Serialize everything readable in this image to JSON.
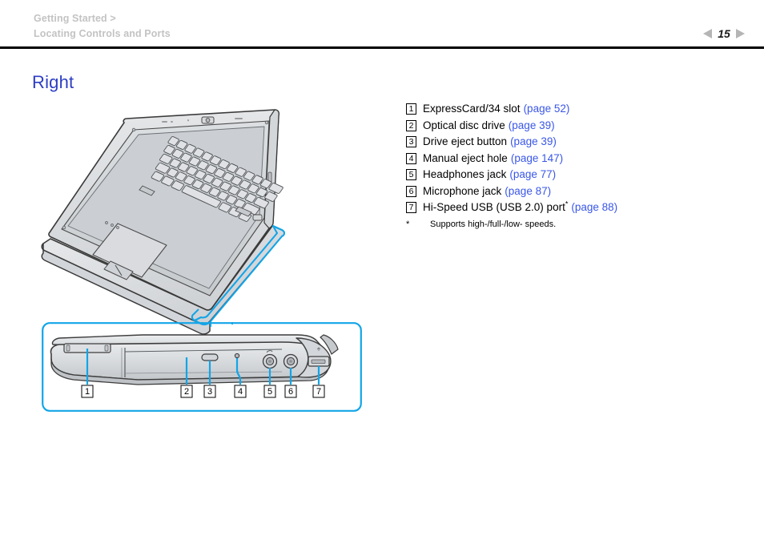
{
  "header": {
    "breadcrumb_line1": "Getting Started >",
    "breadcrumb_line2": "Locating Controls and Ports",
    "page_number": "15",
    "prev_icon": "triangle-left-icon",
    "next_icon": "triangle-right-icon"
  },
  "page": {
    "title": "Right",
    "title_color": "#2c3ec4",
    "link_color": "#3a57e8",
    "highlight_color": "#12a5e8"
  },
  "parts": [
    {
      "num": "1",
      "label": "ExpressCard/34 slot",
      "page_ref": "(page 52)",
      "footnote_mark": ""
    },
    {
      "num": "2",
      "label": "Optical disc drive",
      "page_ref": "(page 39)",
      "footnote_mark": ""
    },
    {
      "num": "3",
      "label": "Drive eject button",
      "page_ref": "(page 39)",
      "footnote_mark": ""
    },
    {
      "num": "4",
      "label": "Manual eject hole",
      "page_ref": "(page 147)",
      "footnote_mark": ""
    },
    {
      "num": "5",
      "label": "Headphones jack",
      "page_ref": "(page 77)",
      "footnote_mark": ""
    },
    {
      "num": "6",
      "label": "Microphone jack",
      "page_ref": "(page 87)",
      "footnote_mark": ""
    },
    {
      "num": "7",
      "label": "Hi-Speed USB (USB 2.0) port",
      "page_ref": "(page 88)",
      "footnote_mark": "*"
    }
  ],
  "footnote": {
    "mark": "*",
    "text": "Supports high-/full-/low- speeds."
  },
  "illustration": {
    "main_view_name": "laptop-three-quarter-view",
    "detail_view_name": "laptop-right-side-detail-view",
    "callouts": [
      {
        "num": "1",
        "part": "expresscard-slot"
      },
      {
        "num": "2",
        "part": "optical-disc-drive"
      },
      {
        "num": "3",
        "part": "drive-eject-button"
      },
      {
        "num": "4",
        "part": "manual-eject-hole"
      },
      {
        "num": "5",
        "part": "headphones-jack"
      },
      {
        "num": "6",
        "part": "microphone-jack"
      },
      {
        "num": "7",
        "part": "usb-port"
      }
    ]
  }
}
